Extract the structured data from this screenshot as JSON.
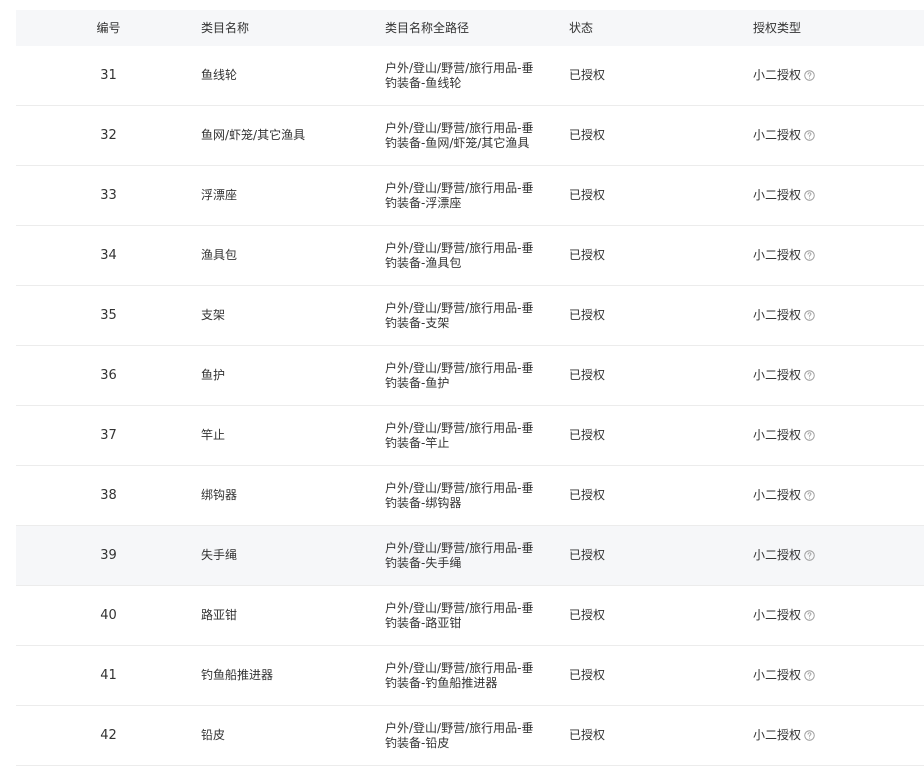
{
  "table": {
    "headers": {
      "id": "编号",
      "name": "类目名称",
      "path": "类目名称全路径",
      "status": "状态",
      "auth_type": "授权类型"
    },
    "rows": [
      {
        "id": "31",
        "name": "鱼线轮",
        "path": "户外/登山/野营/旅行用品-垂钓装备-鱼线轮",
        "status": "已授权",
        "auth_type": "小二授权"
      },
      {
        "id": "32",
        "name": "鱼网/虾笼/其它渔具",
        "path": "户外/登山/野营/旅行用品-垂钓装备-鱼网/虾笼/其它渔具",
        "status": "已授权",
        "auth_type": "小二授权"
      },
      {
        "id": "33",
        "name": "浮漂座",
        "path": "户外/登山/野营/旅行用品-垂钓装备-浮漂座",
        "status": "已授权",
        "auth_type": "小二授权"
      },
      {
        "id": "34",
        "name": "渔具包",
        "path": "户外/登山/野营/旅行用品-垂钓装备-渔具包",
        "status": "已授权",
        "auth_type": "小二授权"
      },
      {
        "id": "35",
        "name": "支架",
        "path": "户外/登山/野营/旅行用品-垂钓装备-支架",
        "status": "已授权",
        "auth_type": "小二授权"
      },
      {
        "id": "36",
        "name": "鱼护",
        "path": "户外/登山/野营/旅行用品-垂钓装备-鱼护",
        "status": "已授权",
        "auth_type": "小二授权"
      },
      {
        "id": "37",
        "name": "竿止",
        "path": "户外/登山/野营/旅行用品-垂钓装备-竿止",
        "status": "已授权",
        "auth_type": "小二授权"
      },
      {
        "id": "38",
        "name": "绑钩器",
        "path": "户外/登山/野营/旅行用品-垂钓装备-绑钩器",
        "status": "已授权",
        "auth_type": "小二授权"
      },
      {
        "id": "39",
        "name": "失手绳",
        "path": "户外/登山/野营/旅行用品-垂钓装备-失手绳",
        "status": "已授权",
        "auth_type": "小二授权"
      },
      {
        "id": "40",
        "name": "路亚钳",
        "path": "户外/登山/野营/旅行用品-垂钓装备-路亚钳",
        "status": "已授权",
        "auth_type": "小二授权"
      },
      {
        "id": "41",
        "name": "钓鱼船推进器",
        "path": "户外/登山/野营/旅行用品-垂钓装备-钓鱼船推进器",
        "status": "已授权",
        "auth_type": "小二授权"
      },
      {
        "id": "42",
        "name": "铅皮",
        "path": "户外/登山/野营/旅行用品-垂钓装备-铅皮",
        "status": "已授权",
        "auth_type": "小二授权"
      }
    ],
    "hovered_row_index": 8
  },
  "colors": {
    "header_bg": "#f6f7f9",
    "row_border": "#ececec",
    "hover_bg": "#f6f7f9",
    "icon": "#999999"
  },
  "icons": {
    "help": "question-circle-icon"
  }
}
